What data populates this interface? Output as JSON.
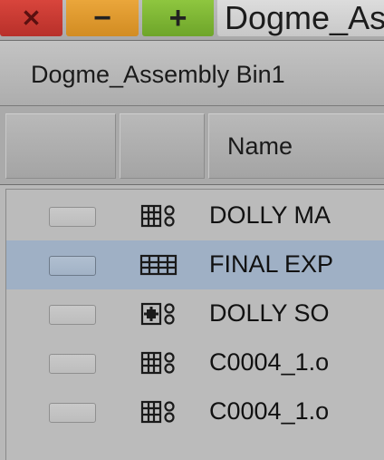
{
  "window": {
    "close_glyph": "✕",
    "minimize_glyph": "−",
    "maximize_glyph": "+",
    "title": "Dogme_As"
  },
  "bin": {
    "title": "Dogme_Assembly Bin1"
  },
  "columns": [
    {
      "label": ""
    },
    {
      "label": ""
    },
    {
      "label": "Name"
    }
  ],
  "rows": [
    {
      "icon": "subclip-icon",
      "name": "DOLLY MA",
      "selected": false
    },
    {
      "icon": "sequence-icon",
      "name": "FINAL EXP",
      "selected": true
    },
    {
      "icon": "group-clip-icon",
      "name": "DOLLY SO",
      "selected": false
    },
    {
      "icon": "subclip-icon",
      "name": "C0004_1.o",
      "selected": false
    },
    {
      "icon": "subclip-icon",
      "name": "C0004_1.o",
      "selected": false
    }
  ],
  "colors": {
    "close": "#c63a31",
    "minimize": "#e09a2e",
    "maximize": "#7db536",
    "selection": "#9fb0c5"
  }
}
